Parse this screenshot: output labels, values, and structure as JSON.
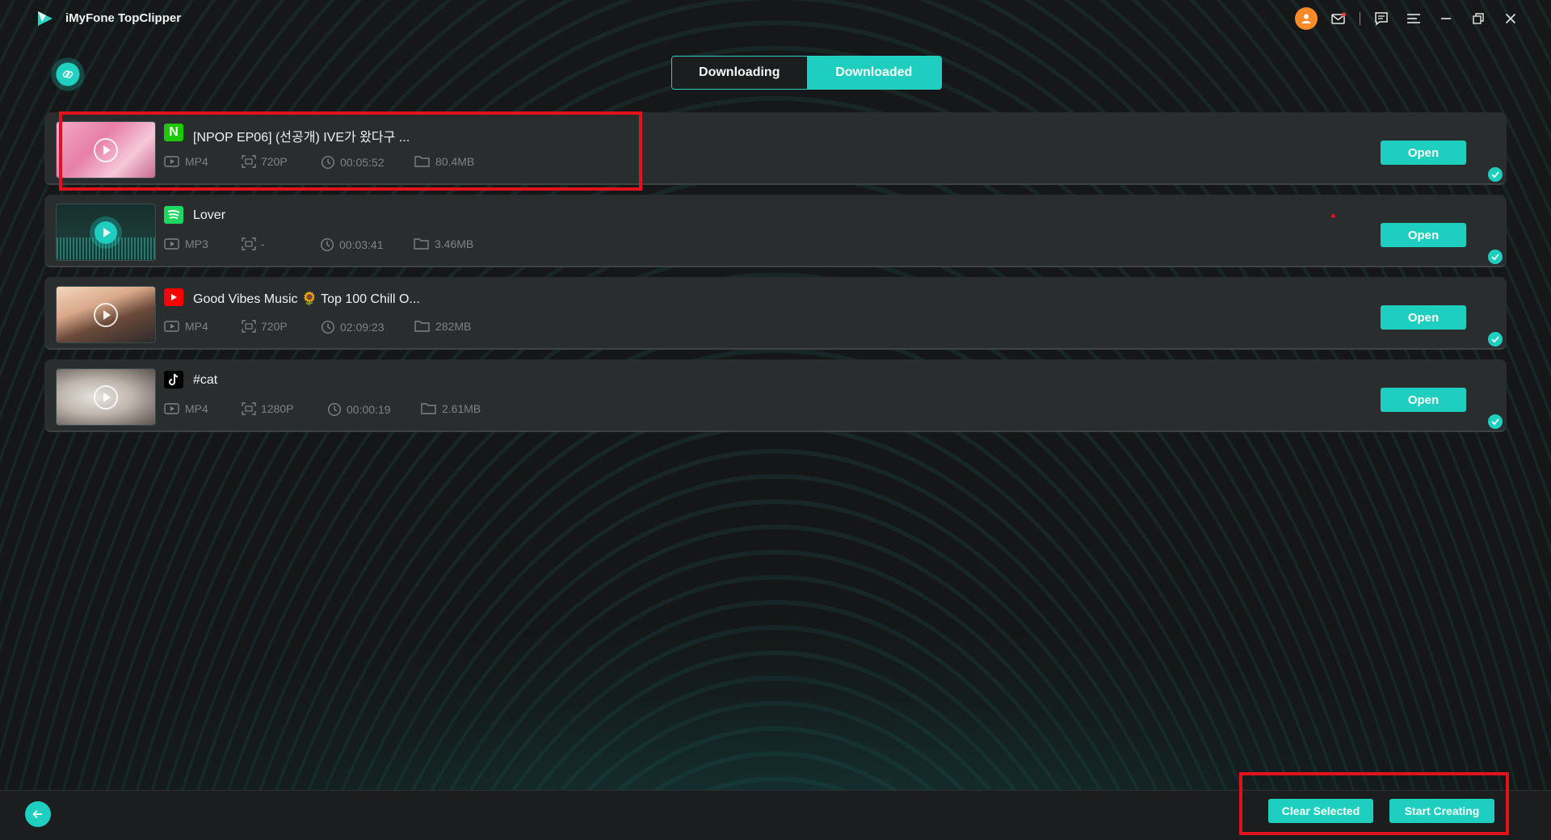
{
  "app": {
    "title": "iMyFone TopClipper"
  },
  "tabs": [
    {
      "label": "Downloading",
      "active": false
    },
    {
      "label": "Downloaded",
      "active": true
    }
  ],
  "items": [
    {
      "source": "N",
      "source_icon": "naver-icon",
      "source_color": "#1ec800",
      "title": "[NPOP EP06] (선공개) IVE가 왔다구 ...",
      "format": "MP4",
      "resolution": "720P",
      "duration": "00:05:52",
      "size": "80.4MB",
      "open_label": "Open"
    },
    {
      "source": "",
      "source_icon": "spotify-icon",
      "source_color": "#1ed760",
      "title": "Lover",
      "format": "MP3",
      "resolution": "-",
      "duration": "00:03:41",
      "size": "3.46MB",
      "open_label": "Open"
    },
    {
      "source": "",
      "source_icon": "youtube-icon",
      "source_color": "#ff0000",
      "title": "Good Vibes Music 🌻 Top 100 Chill O...",
      "format": "MP4",
      "resolution": "720P",
      "duration": "02:09:23",
      "size": "282MB",
      "open_label": "Open"
    },
    {
      "source": "",
      "source_icon": "tiktok-icon",
      "source_color": "#000000",
      "title": "#cat",
      "format": "MP4",
      "resolution": "1280P",
      "duration": "00:00:19",
      "size": "2.61MB",
      "open_label": "Open"
    }
  ],
  "footer": {
    "clear_label": "Clear Selected",
    "start_label": "Start Creating"
  },
  "colors": {
    "accent": "#1ecfc0",
    "highlight": "#e0121b"
  }
}
